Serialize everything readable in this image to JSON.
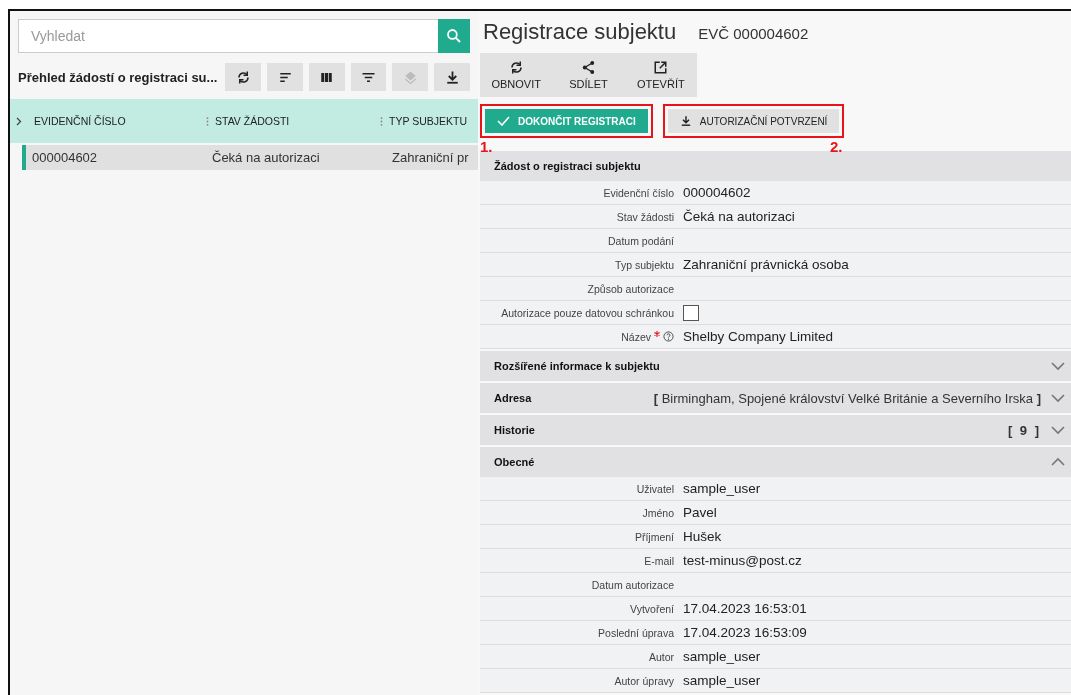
{
  "search": {
    "placeholder": "Vyhledat"
  },
  "list": {
    "title": "Přehled žádostí o registraci su...",
    "tools": [
      {
        "kind": "refresh",
        "disabled": false
      },
      {
        "kind": "sort",
        "disabled": false
      },
      {
        "kind": "columns",
        "disabled": false
      },
      {
        "kind": "filter",
        "disabled": false
      },
      {
        "kind": "layers",
        "disabled": true
      },
      {
        "kind": "download",
        "disabled": false
      }
    ],
    "columns": [
      "EVIDENČNÍ ČÍSLO",
      "STAV ŽÁDOSTI",
      "TYP SUBJEKTU"
    ],
    "rows": [
      {
        "selected": true,
        "cells": [
          "000004602",
          "Čeká na autorizaci",
          "Zahraniční pr"
        ]
      }
    ]
  },
  "detail": {
    "title": "Registrace subjektu",
    "record_id": "EVČ 000004602",
    "toolbar": [
      {
        "kind": "refresh",
        "label": "OBNOVIT"
      },
      {
        "kind": "share",
        "label": "SDÍLET"
      },
      {
        "kind": "open",
        "label": "OTEVŘÍT"
      }
    ],
    "actions": [
      {
        "kind": "primary",
        "label": "DOKONČIT REGISTRACI",
        "annotation": "1."
      },
      {
        "kind": "secondary",
        "label": "AUTORIZAČNÍ POTVRZENÍ",
        "annotation": "2."
      }
    ],
    "form": {
      "title": "Žádost o registraci subjektu",
      "fields": [
        {
          "kind": "text",
          "label": "Evidenční číslo",
          "value": "000004602"
        },
        {
          "kind": "text",
          "label": "Stav žádosti",
          "value": "Čeká na autorizaci"
        },
        {
          "kind": "text",
          "label": "Datum podání"
        },
        {
          "kind": "text",
          "label": "Typ subjektu",
          "value": "Zahraniční právnická osoba"
        },
        {
          "kind": "text",
          "label": "Způsob autorizace"
        },
        {
          "kind": "checkbox",
          "label": "Autorizace pouze datovou schránkou",
          "checked": false
        },
        {
          "kind": "text",
          "label": "Název",
          "required": true,
          "help": true,
          "value": "Shelby Company Limited"
        }
      ]
    },
    "sections": [
      {
        "kind": "plain",
        "title": "Rozšířené informace k subjektu",
        "expanded": false
      },
      {
        "kind": "summary",
        "title": "Adresa",
        "summary": "**[** Birmingham, Spojené království Velké Británie a Severního Irska **]**",
        "expanded": false
      },
      {
        "kind": "count",
        "title": "Historie",
        "summary": "[ 9 ]",
        "expanded": false
      },
      {
        "kind": "plain",
        "title": "Obecné",
        "expanded": true,
        "fields": [
          {
            "kind": "text",
            "label": "Uživatel",
            "value": "sample_user"
          },
          {
            "kind": "text",
            "label": "Jméno",
            "value": "Pavel"
          },
          {
            "kind": "text",
            "label": "Příjmení",
            "value": "Hušek"
          },
          {
            "kind": "text",
            "label": "E-mail",
            "value": "test-minus@post.cz"
          },
          {
            "kind": "text",
            "label": "Datum autorizace"
          },
          {
            "kind": "text",
            "label": "Vytvoření",
            "value": "17.04.2023 16:53:01"
          },
          {
            "kind": "text",
            "label": "Poslední úprava",
            "value": "17.04.2023 16:53:09"
          },
          {
            "kind": "text",
            "label": "Autor",
            "value": "sample_user"
          },
          {
            "kind": "text",
            "label": "Autor úpravy",
            "value": "sample_user"
          }
        ]
      }
    ]
  }
}
